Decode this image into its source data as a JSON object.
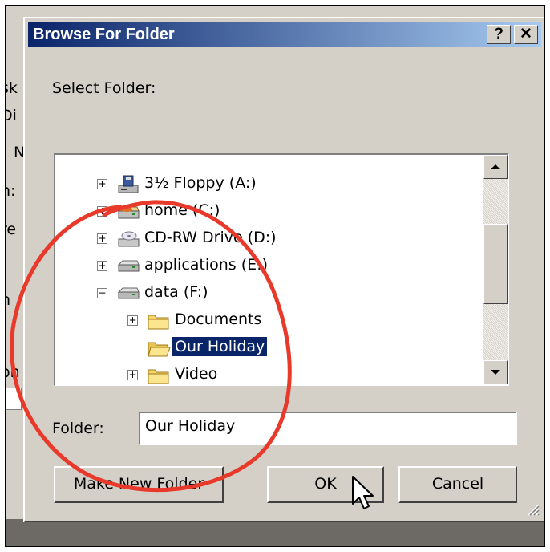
{
  "dialog": {
    "title": "Browse For Folder",
    "help_label": "?",
    "close_label": "✕",
    "select_label": "Select Folder:",
    "folder_label": "Folder:",
    "folder_value": "Our Holiday",
    "buttons": {
      "make_new": "Make New Folder",
      "ok": "OK",
      "cancel": "Cancel"
    }
  },
  "background_fragments": [
    "sk",
    "Di",
    "N",
    "h:",
    "re",
    "n",
    "on"
  ],
  "tree": {
    "items": [
      {
        "label": "3½ Floppy (A:)",
        "icon": "floppy-drive-icon",
        "expander": "+"
      },
      {
        "label": "home (C:)",
        "icon": "hard-drive-icon",
        "expander": "+"
      },
      {
        "label": "CD-RW Drive (D:)",
        "icon": "cd-drive-icon",
        "expander": "+"
      },
      {
        "label": "applications (E:)",
        "icon": "network-drive-icon",
        "expander": "+"
      },
      {
        "label": "data (F:)",
        "icon": "network-drive-icon",
        "expander": "−"
      },
      {
        "label": "Documents",
        "icon": "folder-icon",
        "expander": "+"
      },
      {
        "label": "Our Holiday",
        "icon": "folder-open-icon",
        "expander": "",
        "selected": true
      },
      {
        "label": "Video",
        "icon": "folder-icon",
        "expander": "+"
      }
    ]
  },
  "colors": {
    "titlebar_start": "#0a246a",
    "titlebar_end": "#a6caf0",
    "selection": "#0a246a",
    "annotation": "#e8392a",
    "dialog_face": "#d4d0c8"
  }
}
